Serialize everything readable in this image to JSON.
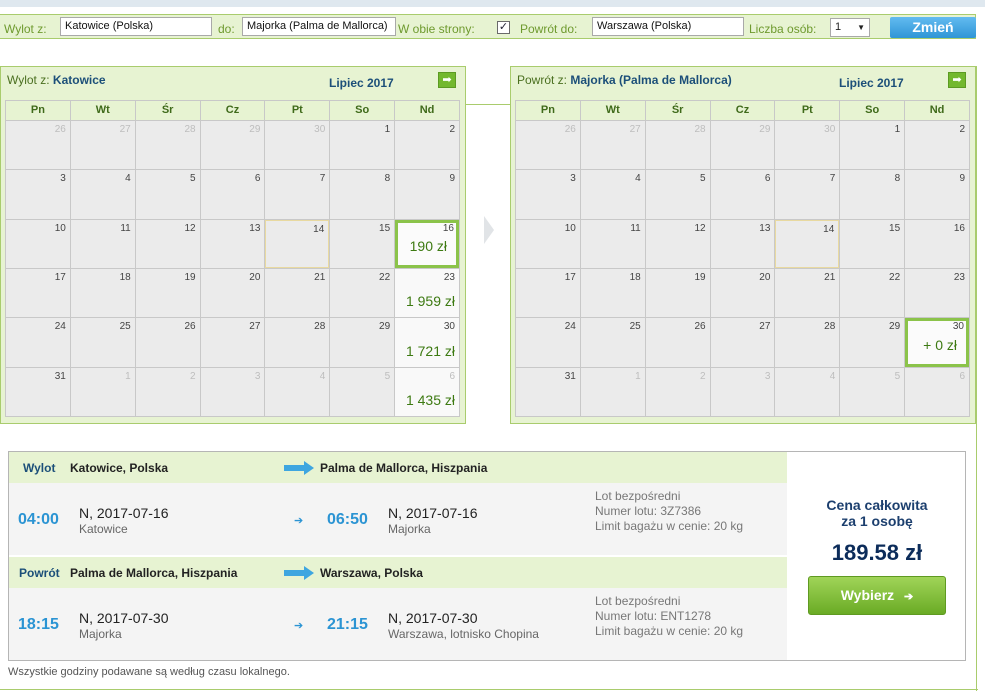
{
  "search": {
    "from_label": "Wylot z:",
    "from_value": "Katowice (Polska)",
    "to_label": "do:",
    "to_value": "Majorka (Palma de Mallorca)",
    "round_trip_label": "W obie strony:",
    "round_trip_checked": "✓",
    "return_label": "Powrót do:",
    "return_value": "Warszawa (Polska)",
    "persons_label": "Liczba osób:",
    "persons_value": "1",
    "change_label": "Zmień"
  },
  "outbound_calendar": {
    "title_prefix": "Wylot z:",
    "title_city": "Katowice",
    "month": "Lipiec 2017",
    "weekdays": [
      "Pn",
      "Wt",
      "Śr",
      "Cz",
      "Pt",
      "So",
      "Nd"
    ],
    "weeks": [
      [
        {
          "d": "26",
          "o": true
        },
        {
          "d": "27",
          "o": true
        },
        {
          "d": "28",
          "o": true
        },
        {
          "d": "29",
          "o": true
        },
        {
          "d": "30",
          "o": true
        },
        {
          "d": "1"
        },
        {
          "d": "2"
        }
      ],
      [
        {
          "d": "3"
        },
        {
          "d": "4"
        },
        {
          "d": "5"
        },
        {
          "d": "6"
        },
        {
          "d": "7"
        },
        {
          "d": "8"
        },
        {
          "d": "9"
        }
      ],
      [
        {
          "d": "10"
        },
        {
          "d": "11"
        },
        {
          "d": "12"
        },
        {
          "d": "13"
        },
        {
          "d": "14",
          "today": true
        },
        {
          "d": "15"
        },
        {
          "d": "16",
          "p": "190 zł",
          "sel": true
        }
      ],
      [
        {
          "d": "17"
        },
        {
          "d": "18"
        },
        {
          "d": "19"
        },
        {
          "d": "20"
        },
        {
          "d": "21"
        },
        {
          "d": "22"
        },
        {
          "d": "23",
          "p": "1 959 zł"
        }
      ],
      [
        {
          "d": "24"
        },
        {
          "d": "25"
        },
        {
          "d": "26"
        },
        {
          "d": "27"
        },
        {
          "d": "28"
        },
        {
          "d": "29"
        },
        {
          "d": "30",
          "p": "1 721 zł"
        }
      ],
      [
        {
          "d": "31"
        },
        {
          "d": "1",
          "o": true
        },
        {
          "d": "2",
          "o": true
        },
        {
          "d": "3",
          "o": true
        },
        {
          "d": "4",
          "o": true
        },
        {
          "d": "5",
          "o": true
        },
        {
          "d": "6",
          "o": true,
          "p": "1 435 zł"
        }
      ]
    ]
  },
  "return_calendar": {
    "title_prefix": "Powrót z:",
    "title_city": "Majorka (Palma de Mallorca)",
    "month": "Lipiec 2017",
    "weekdays": [
      "Pn",
      "Wt",
      "Śr",
      "Cz",
      "Pt",
      "So",
      "Nd"
    ],
    "weeks": [
      [
        {
          "d": "26",
          "o": true
        },
        {
          "d": "27",
          "o": true
        },
        {
          "d": "28",
          "o": true
        },
        {
          "d": "29",
          "o": true
        },
        {
          "d": "30",
          "o": true
        },
        {
          "d": "1"
        },
        {
          "d": "2"
        }
      ],
      [
        {
          "d": "3"
        },
        {
          "d": "4"
        },
        {
          "d": "5"
        },
        {
          "d": "6"
        },
        {
          "d": "7"
        },
        {
          "d": "8"
        },
        {
          "d": "9"
        }
      ],
      [
        {
          "d": "10"
        },
        {
          "d": "11"
        },
        {
          "d": "12"
        },
        {
          "d": "13"
        },
        {
          "d": "14",
          "today": true
        },
        {
          "d": "15"
        },
        {
          "d": "16"
        }
      ],
      [
        {
          "d": "17"
        },
        {
          "d": "18"
        },
        {
          "d": "19"
        },
        {
          "d": "20"
        },
        {
          "d": "21"
        },
        {
          "d": "22"
        },
        {
          "d": "23"
        }
      ],
      [
        {
          "d": "24"
        },
        {
          "d": "25"
        },
        {
          "d": "26"
        },
        {
          "d": "27"
        },
        {
          "d": "28"
        },
        {
          "d": "29"
        },
        {
          "d": "30",
          "p": "+ 0 zł",
          "sel": true
        }
      ],
      [
        {
          "d": "31"
        },
        {
          "d": "1",
          "o": true
        },
        {
          "d": "2",
          "o": true
        },
        {
          "d": "3",
          "o": true
        },
        {
          "d": "4",
          "o": true
        },
        {
          "d": "5",
          "o": true
        },
        {
          "d": "6",
          "o": true
        }
      ]
    ]
  },
  "summary": {
    "outbound": {
      "label": "Wylot",
      "from": "Katowice, Polska",
      "to": "Palma de Mallorca, Hiszpania",
      "dep_time": "04:00",
      "dep_date": "N, 2017-07-16",
      "dep_place": "Katowice",
      "arr_time": "06:50",
      "arr_date": "N, 2017-07-16",
      "arr_place": "Majorka",
      "info1": "Lot bezpośredni",
      "info2": "Numer lotu: 3Z7386",
      "info3": "Limit bagażu w cenie: 20 kg"
    },
    "return": {
      "label": "Powrót",
      "from": "Palma de Mallorca, Hiszpania",
      "to": "Warszawa, Polska",
      "dep_time": "18:15",
      "dep_date": "N, 2017-07-30",
      "dep_place": "Majorka",
      "arr_time": "21:15",
      "arr_date": "N, 2017-07-30",
      "arr_place": "Warszawa, lotnisko Chopina",
      "info1": "Lot bezpośredni",
      "info2": "Numer lotu: ENT1278",
      "info3": "Limit bagażu w cenie: 20 kg"
    },
    "price_title_1": "Cena całkowita",
    "price_title_2": "za 1 osobę",
    "price_value": "189.58 zł",
    "choose_label": "Wybierz"
  },
  "footnote": "Wszystkie godziny podawane są według czasu lokalnego."
}
